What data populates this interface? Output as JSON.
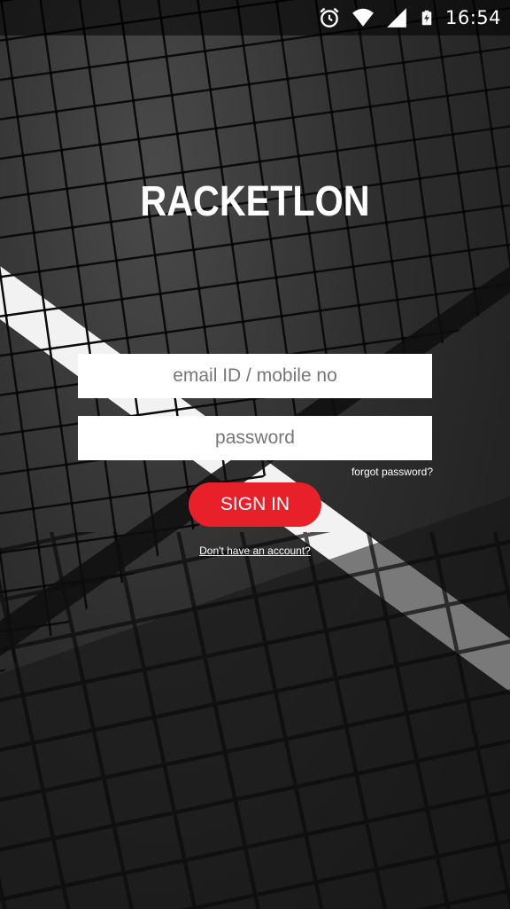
{
  "status_bar": {
    "time": "16:54",
    "icons": [
      "alarm-icon",
      "wifi-icon",
      "signal-icon",
      "battery-icon"
    ]
  },
  "app": {
    "title": "RACKETLON"
  },
  "login_form": {
    "email_placeholder": "email ID / mobile no",
    "password_placeholder": "password",
    "forgot_password_label": "forgot password?",
    "sign_in_label": "SIGN IN",
    "signup_prompt": "Don't have an account?"
  },
  "colors": {
    "accent": "#e8202a",
    "field_background": "#ffffff",
    "text": "#ffffff"
  }
}
